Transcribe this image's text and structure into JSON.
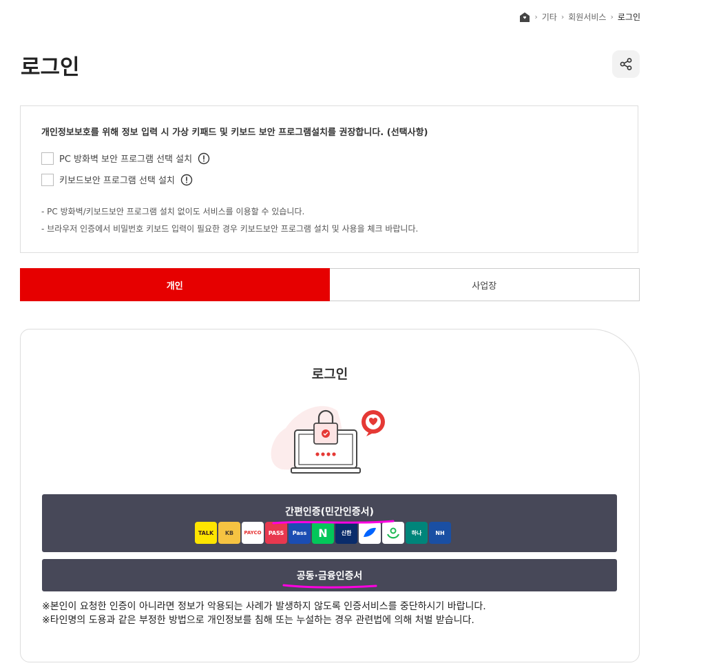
{
  "breadcrumb": {
    "items": [
      "기타",
      "회원서비스",
      "로그인"
    ]
  },
  "page": {
    "title": "로그인"
  },
  "security": {
    "intro": "개인정보보호를 위해 정보 입력 시 가상 키패드 및 키보드 보안 프로그램설치를 권장합니다. (선택사항)",
    "options": [
      {
        "label": "PC 방화벽 보안 프로그램 선택 설치",
        "checked": false
      },
      {
        "label": "키보드보안 프로그램 선택 설치",
        "checked": false
      }
    ],
    "notes": [
      "-  PC 방화벽/키보드보안 프로그램 설치 없이도 서비스를 이용할 수 있습니다.",
      "-  브라우저 인증에서 비밀번호 키보드 입력이 필요한 경우 키보드보안 프로그램 설치 및 사용을 체크 바랍니다."
    ]
  },
  "tabs": [
    {
      "label": "개인",
      "active": true
    },
    {
      "label": "사업장",
      "active": false
    }
  ],
  "login": {
    "title": "로그인",
    "simple_auth_label": "간편인증(민간인증서)",
    "cert_auth_label": "공동·금융인증서",
    "providers": [
      {
        "name": "kakao",
        "text": "TALK",
        "bg": "#fee500",
        "fg": "#3c1e1e"
      },
      {
        "name": "kb",
        "text": "KB",
        "bg": "#f6c342",
        "fg": "#4a3b2a"
      },
      {
        "name": "payco",
        "text": "PAYCO",
        "bg": "#ffffff",
        "fg": "#e63030"
      },
      {
        "name": "pass",
        "text": "PASS",
        "bg": "#e8384f",
        "fg": "#ffffff"
      },
      {
        "name": "samsung-pass",
        "text": "Pass",
        "bg": "#1b4db3",
        "fg": "#ffffff"
      },
      {
        "name": "naver",
        "text": "N",
        "bg": "#03c75a",
        "fg": "#ffffff"
      },
      {
        "name": "shinhan",
        "text": "신한",
        "bg": "#0a2c6b",
        "fg": "#ffffff"
      },
      {
        "name": "toss",
        "text": "",
        "bg": "#ffffff",
        "fg": "#0064ff"
      },
      {
        "name": "green",
        "text": "",
        "bg": "#ffffff",
        "fg": "#1db954"
      },
      {
        "name": "hana",
        "text": "하나",
        "bg": "#00857a",
        "fg": "#ffffff"
      },
      {
        "name": "nh",
        "text": "NH",
        "bg": "#1a4fa3",
        "fg": "#ffffff"
      }
    ],
    "warnings": [
      "※본인이 요청한 인증이 아니라면 정보가 악용되는 사례가 발생하지 않도록 인증서비스를 중단하시기 바랍니다.",
      "※타인명의 도용과 같은 부정한 방법으로 개인정보를 침해 또는 누설하는 경우 관련법에 의해 처벌 받습니다."
    ]
  },
  "colors": {
    "accent": "#e60000",
    "auth_button": "#474858",
    "highlight": "#ff00e1"
  }
}
